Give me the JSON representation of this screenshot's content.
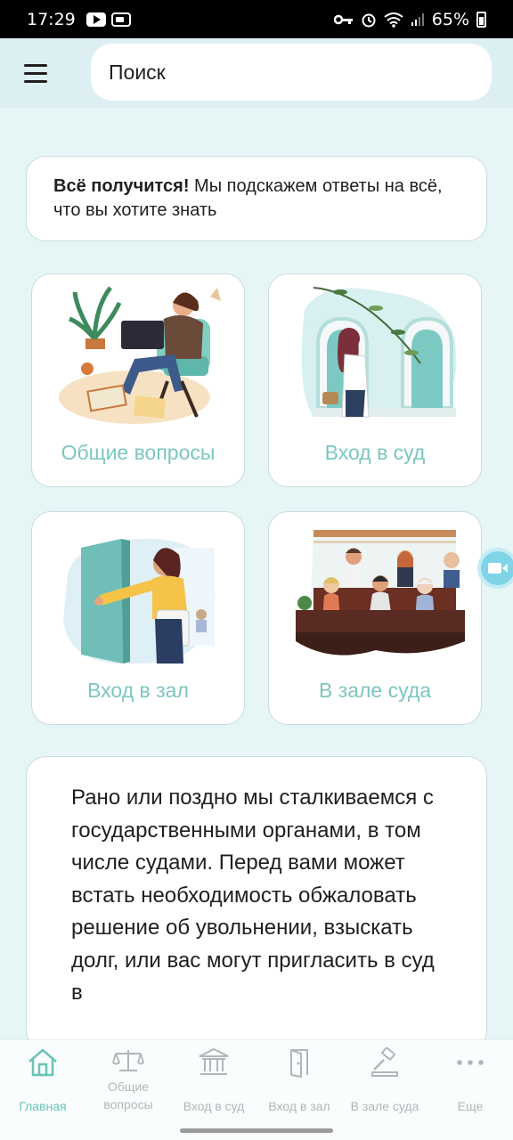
{
  "status_bar": {
    "time": "17:29",
    "battery": "65%"
  },
  "search": {
    "placeholder": "Поиск"
  },
  "intro": {
    "bold": "Всё получится!",
    "text": " Мы подскажем ответы на всё, что вы хотите знать"
  },
  "tiles": [
    {
      "label": "Общие вопросы",
      "icon": "woman-with-laptop-illustration"
    },
    {
      "label": "Вход в суд",
      "icon": "woman-at-court-entrance-illustration"
    },
    {
      "label": "Вход в зал",
      "icon": "woman-opening-door-illustration"
    },
    {
      "label": "В зале суда",
      "icon": "courtroom-audience-illustration"
    }
  ],
  "body_text": "Рано или поздно мы сталкиваемся с государственными органами, в том числе судами. Перед вами может встать необходимость обжаловать решение об увольнении, взыскать долг, или вас могут пригласить в суд в",
  "bottom_nav": [
    {
      "label": "Главная",
      "icon": "home-icon",
      "active": true
    },
    {
      "label": "Общие вопросы",
      "icon": "scales-icon",
      "active": false
    },
    {
      "label": "Вход в суд",
      "icon": "courthouse-icon",
      "active": false
    },
    {
      "label": "Вход в зал",
      "icon": "door-icon",
      "active": false
    },
    {
      "label": "В зале суда",
      "icon": "gavel-icon",
      "active": false
    },
    {
      "label": "Еще",
      "icon": "more-icon",
      "active": false
    }
  ],
  "colors": {
    "accent": "#69c3b9",
    "background": "#e6f5f6",
    "tile_label": "#7cc7c0"
  }
}
